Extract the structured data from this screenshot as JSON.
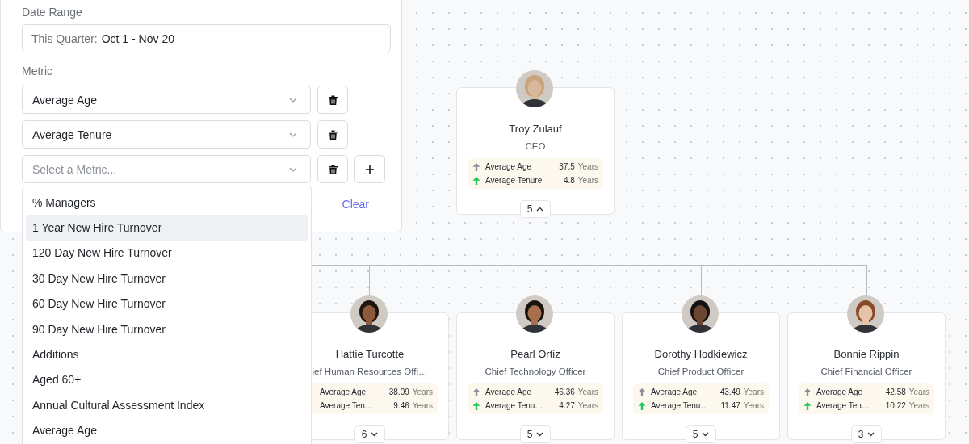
{
  "filter_panel": {
    "date_range": {
      "label": "Date Range",
      "prefix": "This Quarter:",
      "value": "Oct 1 - Nov 20"
    },
    "metric": {
      "label": "Metric",
      "rows": [
        {
          "value": "Average Age",
          "add": false
        },
        {
          "value": "Average Tenure",
          "add": false
        },
        {
          "placeholder": "Select a Metric...",
          "add": true
        }
      ],
      "clear": "Clear"
    }
  },
  "dropdown": {
    "options": [
      {
        "label": "% Managers",
        "selected": false
      },
      {
        "label": "1 Year New Hire Turnover",
        "selected": true
      },
      {
        "label": "120 Day New Hire Turnover",
        "selected": false
      },
      {
        "label": "30 Day New Hire Turnover",
        "selected": false
      },
      {
        "label": "60 Day New Hire Turnover",
        "selected": false
      },
      {
        "label": "90 Day New Hire Turnover",
        "selected": false
      },
      {
        "label": "Additions",
        "selected": false
      },
      {
        "label": "Aged 60+",
        "selected": false
      },
      {
        "label": "Annual Cultural Assessment Index",
        "selected": false
      },
      {
        "label": "Average Age",
        "selected": false
      }
    ]
  },
  "org_chart": {
    "nodes": [
      {
        "name": "Troy Zulauf",
        "title": "CEO",
        "reports": "5",
        "expanded": true,
        "metrics": [
          {
            "label": "Average Age",
            "value": "37.5",
            "unit": "Years",
            "color": "#8a8f98"
          },
          {
            "label": "Average Tenure",
            "value": "4.8",
            "unit": "Years",
            "color": "#22c55e"
          }
        ]
      },
      {
        "name": "Hattie Turcotte",
        "title": "ief Human Resources Offi…",
        "reports": "6",
        "expanded": false,
        "metrics": [
          {
            "label": "Average Age",
            "value": "38.09",
            "unit": "Years"
          },
          {
            "label": "Average Ten…",
            "value": "9.46",
            "unit": "Years"
          }
        ]
      },
      {
        "name": "Pearl Ortiz",
        "title": "Chief Technology Officer",
        "reports": "5",
        "expanded": false,
        "metrics": [
          {
            "label": "Average Age",
            "value": "46.36",
            "unit": "Years",
            "color": "#8a8f98"
          },
          {
            "label": "Average Tenu…",
            "value": "4.27",
            "unit": "Years",
            "color": "#22c55e"
          }
        ]
      },
      {
        "name": "Dorothy Hodkiewicz",
        "title": "Chief Product Officer",
        "reports": "5",
        "expanded": false,
        "metrics": [
          {
            "label": "Average Age",
            "value": "43.49",
            "unit": "Years",
            "color": "#8a8f98"
          },
          {
            "label": "Average Tenu…",
            "value": "11.47",
            "unit": "Years",
            "color": "#22c55e"
          }
        ]
      },
      {
        "name": "Bonnie Rippin",
        "title": "Chief Financial Officer",
        "reports": "3",
        "expanded": false,
        "metrics": [
          {
            "label": "Average Age",
            "value": "42.58",
            "unit": "Years",
            "color": "#8a8f98"
          },
          {
            "label": "Average Ten…",
            "value": "10.22",
            "unit": "Years",
            "color": "#22c55e"
          }
        ]
      }
    ]
  }
}
